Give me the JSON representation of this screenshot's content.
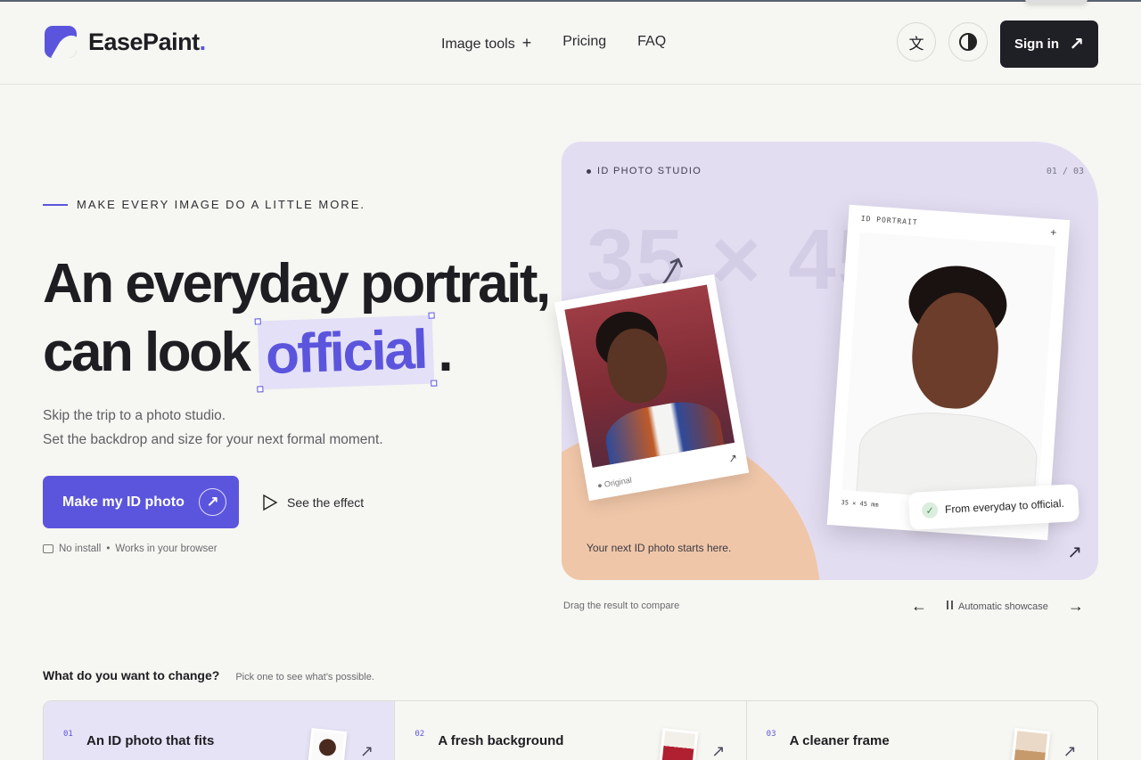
{
  "header": {
    "brand": "EasePaint",
    "brand_dot": ".",
    "nav": [
      {
        "label": "Image tools",
        "suffix": "+"
      },
      {
        "label": "Pricing"
      },
      {
        "label": "FAQ"
      }
    ],
    "lang_glyph": "文",
    "signin_label": "Sign in",
    "signin_arrow": "↗"
  },
  "hero": {
    "eyebrow": "MAKE EVERY IMAGE DO A LITTLE MORE.",
    "title_line1": "An everyday portrait,",
    "title_line2_pre": "can look",
    "title_highlight": "official",
    "title_end": ".",
    "sub_line1": "Skip the trip to a photo studio.",
    "sub_line2": "Set the backdrop and size for your next formal moment.",
    "cta_label": "Make my ID photo",
    "cta_arrow": "↗",
    "see_label": "See the effect",
    "meta_1": "No install",
    "meta_sep": "•",
    "meta_2": "Works in your browser"
  },
  "showcase": {
    "tag": "ID PHOTO STUDIO",
    "count": "01 / 03",
    "big_text": "35 × 45",
    "original_label": "Original",
    "id_label": "ID PORTRAIT",
    "id_plus": "+",
    "id_size": "35 × 45 mm",
    "badge": "From everyday to official.",
    "badge_check": "✓",
    "footer": "Your next ID photo starts here.",
    "footer_arrow": "↗",
    "drag_hint": "Drag the result to compare",
    "prev": "←",
    "next": "→",
    "auto_label": "Automatic showcase"
  },
  "change": {
    "title": "What do you want to change?",
    "subtitle": "Pick one to see what's possible.",
    "options": [
      {
        "num": "01",
        "label": "An ID photo that fits",
        "arrow": "↗"
      },
      {
        "num": "02",
        "label": "A fresh background",
        "arrow": "↗"
      },
      {
        "num": "03",
        "label": "A cleaner frame",
        "arrow": "↗"
      }
    ]
  },
  "colors": {
    "accent": "#5b55dd",
    "dark": "#1f1f26",
    "card_bg": "#e3ddf2",
    "peach": "#f0c6a8"
  }
}
